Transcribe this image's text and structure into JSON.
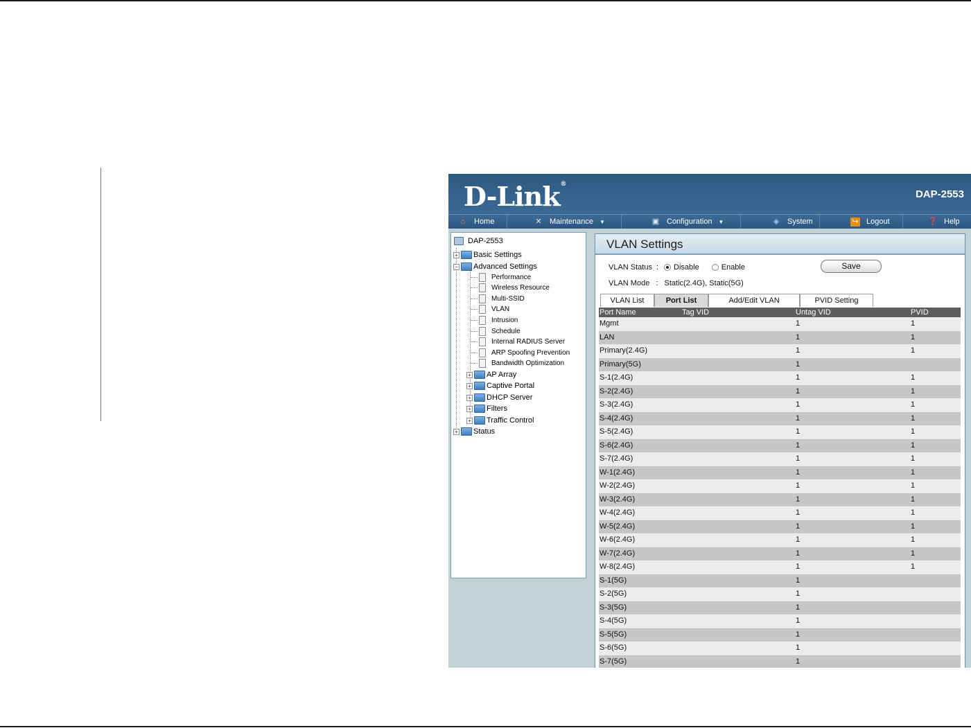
{
  "app": {
    "brand": "D-Link",
    "model": "DAP-2553"
  },
  "nav": [
    {
      "label": "Home",
      "icon": "home-icon"
    },
    {
      "label": "Maintenance",
      "icon": "tools-icon"
    },
    {
      "label": "Configuration",
      "icon": "save-disk-icon"
    },
    {
      "label": "System",
      "icon": "system-icon"
    },
    {
      "label": "Logout",
      "icon": "logout-icon"
    },
    {
      "label": "Help",
      "icon": "help-icon"
    }
  ],
  "tree": {
    "root": "DAP-2553",
    "basic": "Basic Settings",
    "advanced": "Advanced Settings",
    "advanced_items": [
      "Performance",
      "Wireless Resource",
      "Multi-SSID",
      "VLAN",
      "Intrusion",
      "Schedule",
      "Internal RADIUS Server",
      "ARP Spoofing Prevention",
      "Bandwidth Optimization"
    ],
    "advanced_folders": [
      "AP Array",
      "Captive Portal",
      "DHCP Server",
      "Filters",
      "Traffic Control"
    ],
    "status": "Status"
  },
  "panel": {
    "title": "VLAN Settings",
    "status_label": "VLAN Status",
    "sep": ":",
    "disable_label": "Disable",
    "enable_label": "Enable",
    "status_value": "Disable",
    "save_label": "Save",
    "mode_label": "VLAN Mode",
    "mode_value": "Static(2.4G),  Static(5G)"
  },
  "tabs": [
    "VLAN List",
    "Port List",
    "Add/Edit VLAN",
    "PVID Setting"
  ],
  "active_tab": "Port List",
  "table": {
    "headers": [
      "Port Name",
      "Tag VID",
      "Untag VID",
      "PVID"
    ],
    "rows": [
      [
        "Mgmt",
        "",
        "1",
        "1"
      ],
      [
        "LAN",
        "",
        "1",
        "1"
      ],
      [
        "Primary(2.4G)",
        "",
        "1",
        "1"
      ],
      [
        "Primary(5G)",
        "",
        "1",
        ""
      ],
      [
        "S-1(2.4G)",
        "",
        "1",
        "1"
      ],
      [
        "S-2(2.4G)",
        "",
        "1",
        "1"
      ],
      [
        "S-3(2.4G)",
        "",
        "1",
        "1"
      ],
      [
        "S-4(2.4G)",
        "",
        "1",
        "1"
      ],
      [
        "S-5(2.4G)",
        "",
        "1",
        "1"
      ],
      [
        "S-6(2.4G)",
        "",
        "1",
        "1"
      ],
      [
        "S-7(2.4G)",
        "",
        "1",
        "1"
      ],
      [
        "W-1(2.4G)",
        "",
        "1",
        "1"
      ],
      [
        "W-2(2.4G)",
        "",
        "1",
        "1"
      ],
      [
        "W-3(2.4G)",
        "",
        "1",
        "1"
      ],
      [
        "W-4(2.4G)",
        "",
        "1",
        "1"
      ],
      [
        "W-5(2.4G)",
        "",
        "1",
        "1"
      ],
      [
        "W-6(2.4G)",
        "",
        "1",
        "1"
      ],
      [
        "W-7(2.4G)",
        "",
        "1",
        "1"
      ],
      [
        "W-8(2.4G)",
        "",
        "1",
        "1"
      ],
      [
        "S-1(5G)",
        "",
        "1",
        ""
      ],
      [
        "S-2(5G)",
        "",
        "1",
        ""
      ],
      [
        "S-3(5G)",
        "",
        "1",
        ""
      ],
      [
        "S-4(5G)",
        "",
        "1",
        ""
      ],
      [
        "S-5(5G)",
        "",
        "1",
        ""
      ],
      [
        "S-6(5G)",
        "",
        "1",
        ""
      ],
      [
        "S-7(5G)",
        "",
        "1",
        ""
      ]
    ]
  }
}
